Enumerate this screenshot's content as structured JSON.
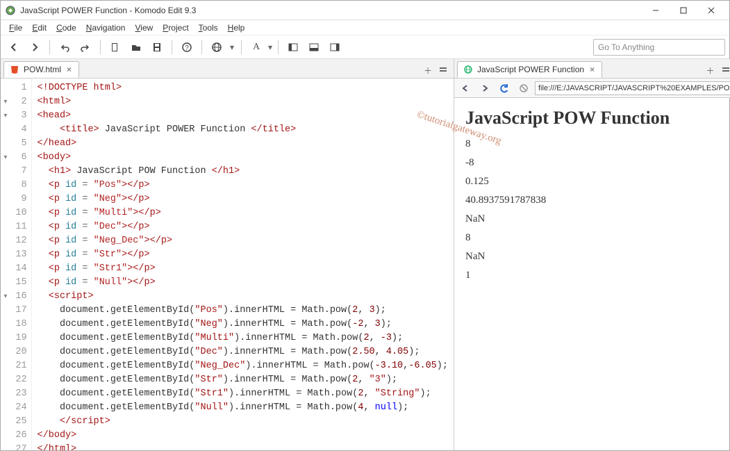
{
  "window": {
    "title": "JavaScript POWER Function - Komodo Edit 9.3"
  },
  "menu": {
    "file": "File",
    "edit": "Edit",
    "code": "Code",
    "navigation": "Navigation",
    "view": "View",
    "project": "Project",
    "tools": "Tools",
    "help": "Help"
  },
  "toolbar": {
    "goto_placeholder": "Go To Anything"
  },
  "left_tab": {
    "label": "POW.html"
  },
  "right_tab": {
    "label": "JavaScript POWER Function"
  },
  "browser": {
    "url": "file:///E:/JAVASCRIPT/JAVASCRIPT%20EXAMPLES/PO"
  },
  "source": {
    "lines": [
      {
        "n": 1,
        "f": "",
        "html": "<span class='tag'>&lt;!DOCTYPE html&gt;</span>"
      },
      {
        "n": 2,
        "f": "▾",
        "html": "<span class='tag'>&lt;html&gt;</span>"
      },
      {
        "n": 3,
        "f": "▾",
        "html": "<span class='tag'>&lt;head&gt;</span>"
      },
      {
        "n": 4,
        "f": "",
        "html": "    <span class='tag'>&lt;title&gt;</span><span class='txt'> JavaScript POWER Function </span><span class='tag'>&lt;/title&gt;</span>"
      },
      {
        "n": 5,
        "f": "",
        "html": "<span class='tag'>&lt;/head&gt;</span>"
      },
      {
        "n": 6,
        "f": "▾",
        "html": "<span class='tag'>&lt;body&gt;</span>"
      },
      {
        "n": 7,
        "f": "",
        "html": "  <span class='tag'>&lt;h1&gt;</span><span class='txt'> JavaScript POW Function </span><span class='tag'>&lt;/h1&gt;</span>"
      },
      {
        "n": 8,
        "f": "",
        "html": "  <span class='tag'>&lt;p</span> <span class='attr'>id</span> <span class='eq'>=</span> <span class='str'>\"Pos\"</span><span class='tag'>&gt;&lt;/p&gt;</span>"
      },
      {
        "n": 9,
        "f": "",
        "html": "  <span class='tag'>&lt;p</span> <span class='attr'>id</span> <span class='eq'>=</span> <span class='str'>\"Neg\"</span><span class='tag'>&gt;&lt;/p&gt;</span>"
      },
      {
        "n": 10,
        "f": "",
        "html": "  <span class='tag'>&lt;p</span> <span class='attr'>id</span> <span class='eq'>=</span> <span class='str'>\"Multi\"</span><span class='tag'>&gt;&lt;/p&gt;</span>"
      },
      {
        "n": 11,
        "f": "",
        "html": "  <span class='tag'>&lt;p</span> <span class='attr'>id</span> <span class='eq'>=</span> <span class='str'>\"Dec\"</span><span class='tag'>&gt;&lt;/p&gt;</span>"
      },
      {
        "n": 12,
        "f": "",
        "html": "  <span class='tag'>&lt;p</span> <span class='attr'>id</span> <span class='eq'>=</span> <span class='str'>\"Neg_Dec\"</span><span class='tag'>&gt;&lt;/p&gt;</span>"
      },
      {
        "n": 13,
        "f": "",
        "html": "  <span class='tag'>&lt;p</span> <span class='attr'>id</span> <span class='eq'>=</span> <span class='str'>\"Str\"</span><span class='tag'>&gt;&lt;/p&gt;</span>"
      },
      {
        "n": 14,
        "f": "",
        "html": "  <span class='tag'>&lt;p</span> <span class='attr'>id</span> <span class='eq'>=</span> <span class='str'>\"Str1\"</span><span class='tag'>&gt;&lt;/p&gt;</span>"
      },
      {
        "n": 15,
        "f": "",
        "html": "  <span class='tag'>&lt;p</span> <span class='attr'>id</span> <span class='eq'>=</span> <span class='str'>\"Null\"</span><span class='tag'>&gt;&lt;/p&gt;</span>"
      },
      {
        "n": 16,
        "f": "▾",
        "html": "  <span class='tag'>&lt;script&gt;</span>"
      },
      {
        "n": 17,
        "f": "",
        "html": "    <span class='js'>document.getElementById(</span><span class='jstr'>\"Pos\"</span><span class='js'>).innerHTML = Math.pow(</span><span class='num'>2</span><span class='js'>, </span><span class='num'>3</span><span class='js'>);</span>"
      },
      {
        "n": 18,
        "f": "",
        "html": "    <span class='js'>document.getElementById(</span><span class='jstr'>\"Neg\"</span><span class='js'>).innerHTML = Math.pow(</span><span class='num'>-2</span><span class='js'>, </span><span class='num'>3</span><span class='js'>);</span>"
      },
      {
        "n": 19,
        "f": "",
        "html": "    <span class='js'>document.getElementById(</span><span class='jstr'>\"Multi\"</span><span class='js'>).innerHTML = Math.pow(</span><span class='num'>2</span><span class='js'>, </span><span class='num'>-3</span><span class='js'>);</span>"
      },
      {
        "n": 20,
        "f": "",
        "html": "    <span class='js'>document.getElementById(</span><span class='jstr'>\"Dec\"</span><span class='js'>).innerHTML = Math.pow(</span><span class='num'>2.50</span><span class='js'>, </span><span class='num'>4.05</span><span class='js'>);</span>"
      },
      {
        "n": 21,
        "f": "",
        "html": "    <span class='js'>document.getElementById(</span><span class='jstr'>\"Neg_Dec\"</span><span class='js'>).innerHTML = Math.pow(</span><span class='num'>-3.10</span><span class='js'>,</span><span class='num'>-6.05</span><span class='js'>);</span>"
      },
      {
        "n": 22,
        "f": "",
        "html": "    <span class='js'>document.getElementById(</span><span class='jstr'>\"Str\"</span><span class='js'>).innerHTML = Math.pow(</span><span class='num'>2</span><span class='js'>, </span><span class='jstr'>\"3\"</span><span class='js'>);</span>"
      },
      {
        "n": 23,
        "f": "",
        "html": "    <span class='js'>document.getElementById(</span><span class='jstr'>\"Str1\"</span><span class='js'>).innerHTML = Math.pow(</span><span class='num'>2</span><span class='js'>, </span><span class='jstr'>\"String\"</span><span class='js'>);</span>"
      },
      {
        "n": 24,
        "f": "",
        "html": "    <span class='js'>document.getElementById(</span><span class='jstr'>\"Null\"</span><span class='js'>).innerHTML = Math.pow(</span><span class='num'>4</span><span class='js'>, </span><span class='kw'>null</span><span class='js'>);</span>"
      },
      {
        "n": 25,
        "f": "",
        "html": "    <span class='tag'>&lt;/script&gt;</span>"
      },
      {
        "n": 26,
        "f": "",
        "html": "<span class='tag'>&lt;/body&gt;</span>"
      },
      {
        "n": 27,
        "f": "",
        "html": "<span class='tag'>&lt;/html&gt;</span>"
      }
    ]
  },
  "preview": {
    "h1": "JavaScript POW Function",
    "p": [
      "8",
      "-8",
      "0.125",
      "40.8937591787838",
      "NaN",
      "8",
      "NaN",
      "1"
    ]
  },
  "watermark": "©tutorialgateway.org"
}
